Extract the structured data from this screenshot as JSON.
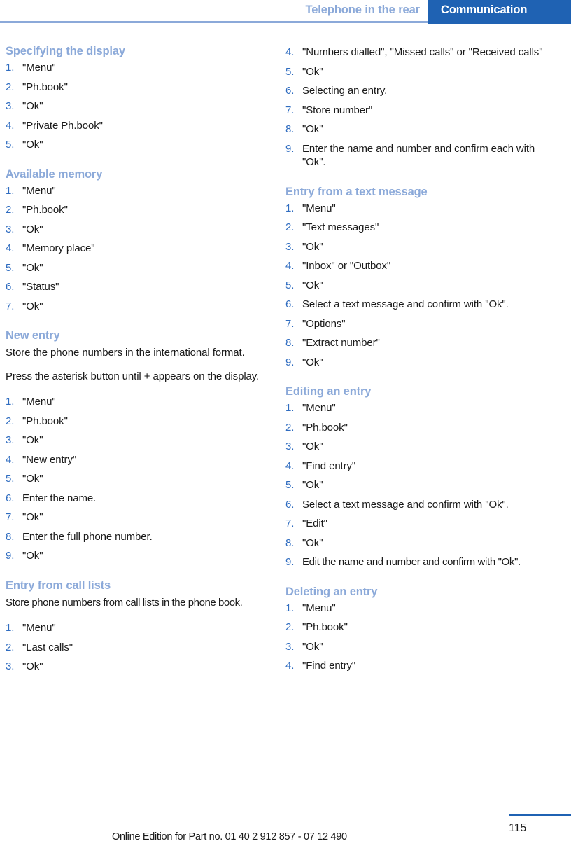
{
  "header": {
    "chapter": "Telephone in the rear",
    "tab": "Communication"
  },
  "columns": {
    "left": [
      {
        "heading": "Specifying the display",
        "paragraphs": [],
        "steps": [
          "\"Menu\"",
          "\"Ph.book\"",
          "\"Ok\"",
          "\"Private Ph.book\"",
          "\"Ok\""
        ]
      },
      {
        "heading": "Available memory",
        "paragraphs": [],
        "steps": [
          "\"Menu\"",
          "\"Ph.book\"",
          "\"Ok\"",
          "\"Memory place\"",
          "\"Ok\"",
          "\"Status\"",
          "\"Ok\""
        ]
      },
      {
        "heading": "New entry",
        "paragraphs": [
          "Store the phone numbers in the international format.",
          "Press the asterisk button until + appears on the display."
        ],
        "steps": [
          "\"Menu\"",
          "\"Ph.book\"",
          "\"Ok\"",
          "\"New entry\"",
          "\"Ok\"",
          "Enter the name.",
          "\"Ok\"",
          "Enter the full phone number.",
          "\"Ok\""
        ]
      },
      {
        "heading": "Entry from call lists",
        "paragraphs": [
          "Store phone numbers from call lists in the phone book."
        ],
        "steps": [
          "\"Menu\"",
          "\"Last calls\"",
          "\"Ok\""
        ]
      }
    ],
    "right": [
      {
        "heading": "",
        "paragraphs": [],
        "start": 4,
        "steps": [
          "\"Numbers dialled\", \"Missed calls\" or \"Received calls\"",
          "\"Ok\"",
          "Selecting an entry.",
          "\"Store number\"",
          "\"Ok\"",
          "Enter the name and number and confirm each with \"Ok\"."
        ]
      },
      {
        "heading": "Entry from a text message",
        "paragraphs": [],
        "steps": [
          "\"Menu\"",
          "\"Text messages\"",
          "\"Ok\"",
          "\"Inbox\" or \"Outbox\"",
          "\"Ok\"",
          "Select a text message and confirm with \"Ok\".",
          "\"Options\"",
          "\"Extract number\"",
          "\"Ok\""
        ]
      },
      {
        "heading": "Editing an entry",
        "paragraphs": [],
        "steps": [
          "\"Menu\"",
          "\"Ph.book\"",
          "\"Ok\"",
          "\"Find entry\"",
          "\"Ok\"",
          "Select a text message and confirm with \"Ok\".",
          "\"Edit\"",
          "\"Ok\"",
          "Edit the name and number and confirm with \"Ok\"."
        ]
      },
      {
        "heading": "Deleting an entry",
        "paragraphs": [],
        "steps": [
          "\"Menu\"",
          "\"Ph.book\"",
          "\"Ok\"",
          "\"Find entry\""
        ]
      }
    ]
  },
  "footer": {
    "note": "Online Edition for Part no. 01 40 2 912 857 - 07 12 490",
    "page": "115"
  },
  "colors": {
    "heading_blue": "#8ba9d9",
    "number_blue": "#2f6cc0",
    "tab_blue": "#1f62b3",
    "text_black": "#1a1a1a"
  }
}
